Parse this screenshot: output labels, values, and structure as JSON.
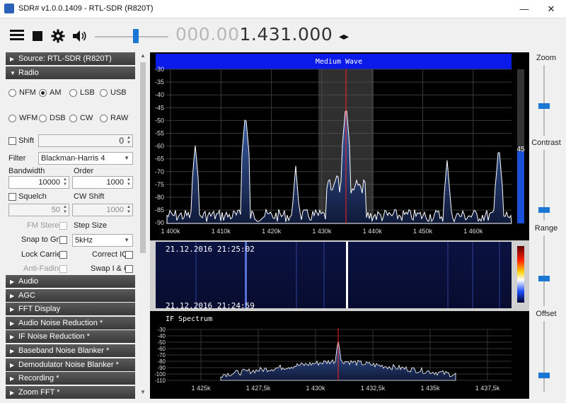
{
  "window": {
    "title": "SDR# v1.0.0.1409 - RTL-SDR (R820T)",
    "minimize": "—",
    "maximize": "☐",
    "close": "✕"
  },
  "toolbar": {
    "freq_dim": "000.00",
    "freq_bright": "1.431.000",
    "step_arrows": "◂▸"
  },
  "panel": {
    "source_section": "Source: RTL-SDR (R820T)",
    "radio_section": "Radio",
    "modes": [
      {
        "label": "NFM",
        "selected": false
      },
      {
        "label": "AM",
        "selected": true
      },
      {
        "label": "LSB",
        "selected": false
      },
      {
        "label": "USB",
        "selected": false
      },
      {
        "label": "WFM",
        "selected": false
      },
      {
        "label": "DSB",
        "selected": false
      },
      {
        "label": "CW",
        "selected": false
      },
      {
        "label": "RAW",
        "selected": false
      }
    ],
    "shift_label": "Shift",
    "shift_value": "0",
    "filter_label": "Filter",
    "filter_value": "Blackman-Harris 4",
    "bandwidth_label": "Bandwidth",
    "bandwidth_value": "10000",
    "order_label": "Order",
    "order_value": "1000",
    "squelch_label": "Squelch",
    "squelch_value": "50",
    "cwshift_label": "CW Shift",
    "cwshift_value": "1000",
    "fmstereo_label": "FM Stereo",
    "stepsize_label": "Step Size",
    "snap_label": "Snap to Grid",
    "snap_value": "5kHz",
    "lockcarrier_label": "Lock Carrier",
    "correctiq_label": "Correct IQ",
    "antifading_label": "Anti-Fading",
    "swapiq_label": "Swap I & Q",
    "sections": [
      "Audio",
      "AGC",
      "FFT Display",
      "Audio Noise Reduction *",
      "IF Noise Reduction *",
      "Baseband Noise Blanker *",
      "Demodulator Noise Blanker *",
      "Recording *",
      "Zoom FFT *"
    ]
  },
  "spectrum": {
    "band_label": "Medium Wave",
    "db_ticks": [
      "-30",
      "-35",
      "-40",
      "-45",
      "-50",
      "-55",
      "-60",
      "-65",
      "-70",
      "-75",
      "-80",
      "-85",
      "-90"
    ],
    "freq_ticks": [
      "1 400k",
      "1 410k",
      "1 420k",
      "1 430k",
      "1 440k",
      "1 450k",
      "1 460k"
    ],
    "level_value": "45"
  },
  "waterfall": {
    "time_top": "21.12.2016 21:25:02",
    "time_bottom": "21.12.2016 21:24:59"
  },
  "if_spectrum": {
    "title": "IF Spectrum",
    "db_ticks": [
      "-30",
      "-40",
      "-50",
      "-60",
      "-70",
      "-80",
      "-90",
      "-100",
      "-110"
    ],
    "freq_ticks": [
      "1 425k",
      "1 427,5k",
      "1 430k",
      "1 432,5k",
      "1 435k",
      "1 437,5k"
    ]
  },
  "right_panel": {
    "zoom": "Zoom",
    "contrast": "Contrast",
    "range": "Range",
    "offset": "Offset"
  },
  "colors": {
    "accent": "#1a78d4",
    "band_bar": "#0a1ae8",
    "trace": "#ffffff",
    "marker": "#ff2020"
  }
}
